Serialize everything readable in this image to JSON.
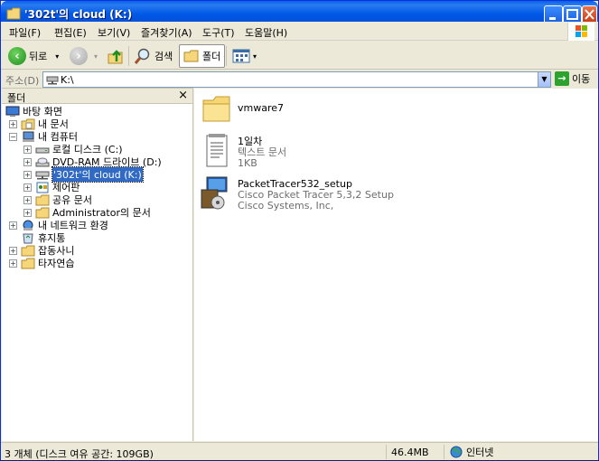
{
  "window": {
    "title": "'302t'의 cloud (K:)"
  },
  "menu": [
    "파일(F)",
    "편집(E)",
    "보기(V)",
    "즐겨찾기(A)",
    "도구(T)",
    "도움말(H)"
  ],
  "toolbar": {
    "back_label": "뒤로",
    "search_label": "검색",
    "folders_label": "폴더"
  },
  "address": {
    "label": "주소(D)",
    "value": "K:\\",
    "go_label": "이동"
  },
  "folder_pane": {
    "title": "폴더",
    "close": "×",
    "items": [
      {
        "label": "바탕 화면",
        "icon": "desktop-icon"
      },
      {
        "label": "내 문서",
        "icon": "my-documents-icon",
        "expander": "+"
      },
      {
        "label": "내 컴퓨터",
        "icon": "my-computer-icon",
        "expander": "−"
      },
      {
        "label": "로컬 디스크 (C:)",
        "icon": "local-disk-icon",
        "expander": "+"
      },
      {
        "label": "DVD-RAM 드라이브 (D:)",
        "icon": "dvd-drive-icon",
        "expander": "+"
      },
      {
        "label": "'302t'의 cloud (K:)",
        "icon": "network-drive-icon",
        "expander": "+",
        "selected": true
      },
      {
        "label": "제어판",
        "icon": "control-panel-icon",
        "expander": "+"
      },
      {
        "label": "공유 문서",
        "icon": "folder-icon",
        "expander": "+"
      },
      {
        "label": "Administrator의 문서",
        "icon": "folder-icon",
        "expander": "+"
      },
      {
        "label": "내 네트워크 환경",
        "icon": "network-places-icon",
        "expander": "+"
      },
      {
        "label": "휴지통",
        "icon": "recycle-bin-icon"
      },
      {
        "label": "잡동사니",
        "icon": "folder-icon",
        "expander": "+"
      },
      {
        "label": "타자연습",
        "icon": "folder-icon",
        "expander": "+"
      }
    ]
  },
  "files": [
    {
      "name": "vmware7",
      "lines": [],
      "icon": "folder-icon"
    },
    {
      "name": "1일차",
      "lines": [
        "텍스트 문서",
        "1KB"
      ],
      "icon": "text-document-icon"
    },
    {
      "name": "PacketTracer532_setup",
      "lines": [
        "Cisco Packet Tracer 5,3,2 Setup",
        "Cisco Systems, Inc,"
      ],
      "icon": "installer-icon"
    }
  ],
  "status": {
    "objects": "3 개체 (디스크 여유 공간: 109GB)",
    "size": "46.4MB",
    "zone": "인터넷"
  }
}
